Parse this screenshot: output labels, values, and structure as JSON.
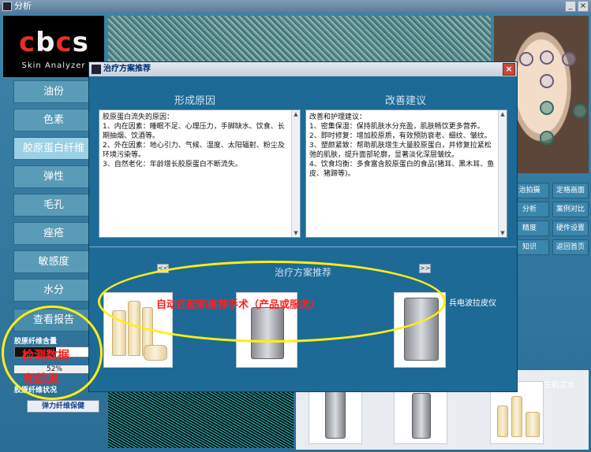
{
  "window": {
    "title": "分析",
    "minimize": "_",
    "close": "×"
  },
  "logo": {
    "letters": [
      "c",
      "b",
      "c",
      "s"
    ],
    "subtitle": "Skin Analyzer"
  },
  "sidebar": {
    "items": [
      {
        "label": "油份"
      },
      {
        "label": "色素"
      },
      {
        "label": "胶原蛋白纤维"
      },
      {
        "label": "弹性"
      },
      {
        "label": "毛孔"
      },
      {
        "label": "痤疮"
      },
      {
        "label": "敏感度"
      },
      {
        "label": "水分"
      },
      {
        "label": "查看报告"
      }
    ]
  },
  "stats": {
    "content_label": "胶原纤维含量",
    "value": "52%",
    "fill_fraction": 0.52,
    "status_label": "胶原纤维状况",
    "action_button": "弹力纤维保健"
  },
  "right_buttons": [
    "治拍摄",
    "定格画面",
    "分析",
    "案例对比",
    "精度",
    "硬件设置",
    "知识",
    "返回首页"
  ],
  "bottom_labels": [
    "仪",
    "生机之水"
  ],
  "dialog": {
    "title": "治疗方案推荐",
    "close": "×",
    "cause_heading": "形成原因",
    "advice_heading": "改善建议",
    "cause_lines": [
      "胶原蛋白流失的原因：",
      "1、内在因素：睡眠不足、心理压力，手脚缺水、饮食、长期抽烟、饮酒等。",
      "2、外在因素：地心引力、气候、湿度、太阳辐射、粉尘及环境污染等。",
      "3、自然老化：年龄增长胶原蛋白不断流失。"
    ],
    "advice_lines": [
      "改善和护理建议：",
      "1、密集保湿：保持肌肤水分充盈，肌肤畅饮更多营养。",
      "2、即时修复：增加胶原质，有效预防衰老、细纹、皱纹。",
      "3、塑颜紧致：帮助肌肤增生大量胶原蛋白，并修复拉紧松弛的肌肤，提升面部轮廓，显著淡化深层皱纹。",
      "4、饮食均衡：多食富含胶原蛋白的食品(猪耳、黑木耳、鱼皮、猪蹄等)。"
    ],
    "recommend_heading": "治疗方案推荐",
    "prev": "<<",
    "next": ">>",
    "product_side_label": "兵电波拉皮仪"
  },
  "annotations": {
    "recommend_note": "自动匹配和推荐手术（产品或服务）",
    "result_note_1": "检测数据",
    "result_note_2": "和结果"
  },
  "colors": {
    "annotation_yellow": "#ffee14",
    "annotation_red": "#ff1f1f",
    "accent_blue": "#1d6a97"
  }
}
